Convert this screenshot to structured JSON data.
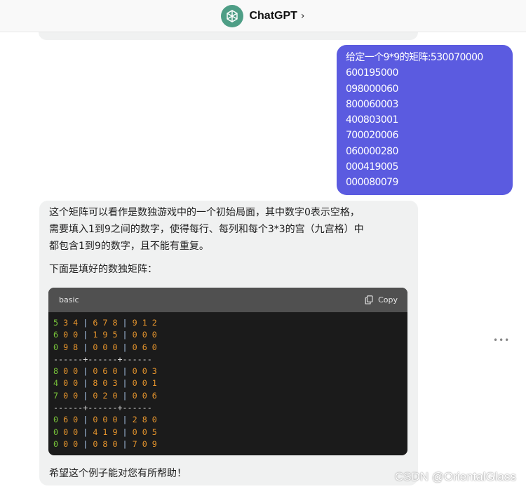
{
  "header": {
    "app_title": "ChatGPT",
    "chevron_icon": "chevron-right-icon"
  },
  "user_message": {
    "lines": [
      "给定一个9*9的矩阵:530070000",
      "600195000",
      "098000060",
      "800060003",
      "400803001",
      "700020006",
      "060000280",
      "000419005",
      "000080079"
    ],
    "color": "#5b5be0"
  },
  "assistant_message": {
    "paragraph_1": [
      "这个矩阵可以看作是数独游戏中的一个初始局面，其中数字0表示空格，",
      "需要填入1到9之间的数字，使得每行、每列和每个3*3的宫（九宫格）中",
      "都包含1到9的数字，且不能有重复。"
    ],
    "paragraph_2": "下面是填好的数独矩阵：",
    "code_block": {
      "language": "basic",
      "copy_label": "Copy",
      "separator": "------+------+------",
      "rows": [
        [
          "5 3 4",
          "6 7 8",
          "9 1 2"
        ],
        [
          "6 0 0",
          "1 9 5",
          "0 0 0"
        ],
        [
          "0 9 8",
          "0 0 0",
          "0 6 0"
        ],
        [
          "8 0 0",
          "0 6 0",
          "0 0 3"
        ],
        [
          "4 0 0",
          "8 0 3",
          "0 0 1"
        ],
        [
          "7 0 0",
          "0 2 0",
          "0 0 6"
        ],
        [
          "0 6 0",
          "0 0 0",
          "2 8 0"
        ],
        [
          "0 0 0",
          "4 1 9",
          "0 0 5"
        ],
        [
          "0 0 0",
          "0 8 0",
          "7 0 9"
        ]
      ]
    },
    "paragraph_3": "希望这个例子能对您有所帮助！"
  },
  "more_options": "•••",
  "watermark": "CSDN @OrientalGlass"
}
